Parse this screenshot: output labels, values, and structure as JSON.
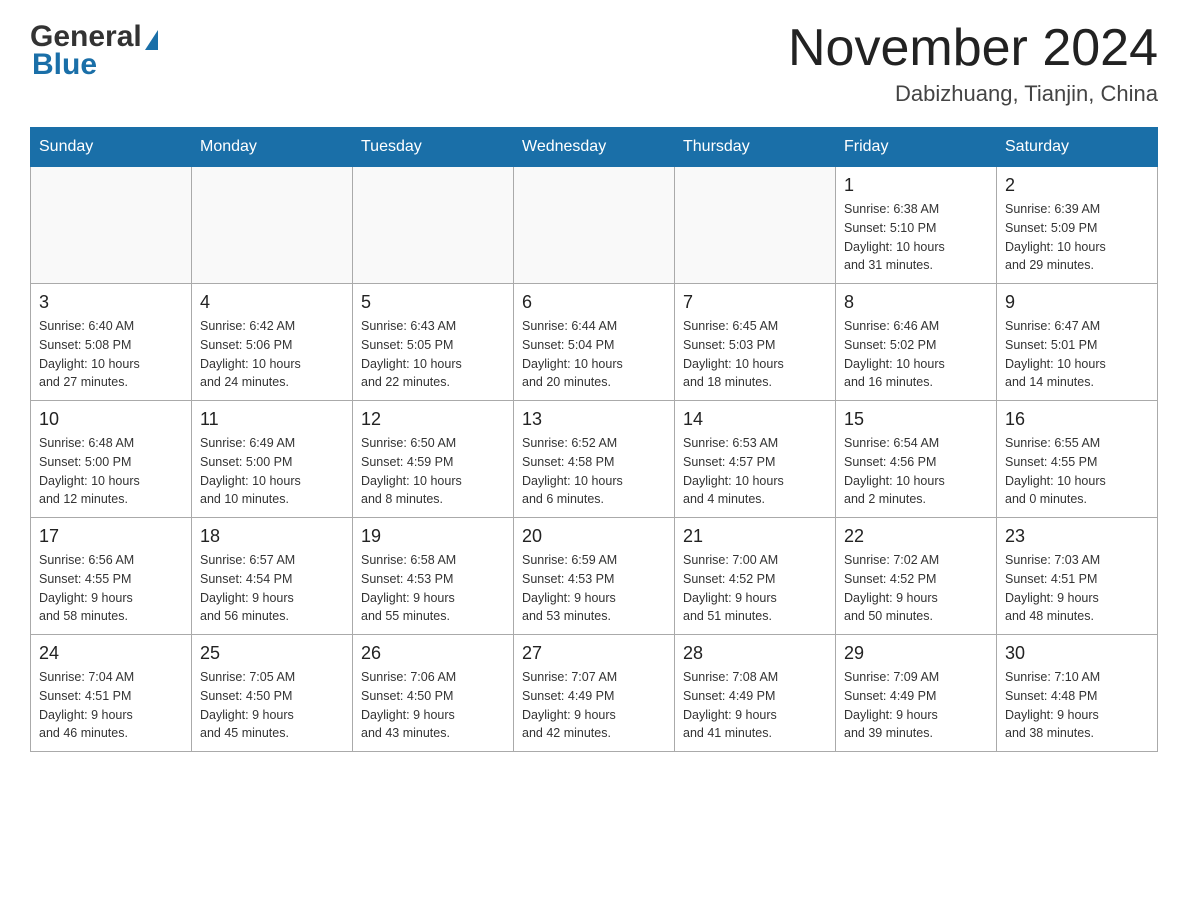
{
  "header": {
    "month_title": "November 2024",
    "location": "Dabizhuang, Tianjin, China",
    "logo_general": "General",
    "logo_blue": "Blue"
  },
  "weekdays": [
    "Sunday",
    "Monday",
    "Tuesday",
    "Wednesday",
    "Thursday",
    "Friday",
    "Saturday"
  ],
  "weeks": [
    [
      {
        "day": "",
        "info": ""
      },
      {
        "day": "",
        "info": ""
      },
      {
        "day": "",
        "info": ""
      },
      {
        "day": "",
        "info": ""
      },
      {
        "day": "",
        "info": ""
      },
      {
        "day": "1",
        "info": "Sunrise: 6:38 AM\nSunset: 5:10 PM\nDaylight: 10 hours\nand 31 minutes."
      },
      {
        "day": "2",
        "info": "Sunrise: 6:39 AM\nSunset: 5:09 PM\nDaylight: 10 hours\nand 29 minutes."
      }
    ],
    [
      {
        "day": "3",
        "info": "Sunrise: 6:40 AM\nSunset: 5:08 PM\nDaylight: 10 hours\nand 27 minutes."
      },
      {
        "day": "4",
        "info": "Sunrise: 6:42 AM\nSunset: 5:06 PM\nDaylight: 10 hours\nand 24 minutes."
      },
      {
        "day": "5",
        "info": "Sunrise: 6:43 AM\nSunset: 5:05 PM\nDaylight: 10 hours\nand 22 minutes."
      },
      {
        "day": "6",
        "info": "Sunrise: 6:44 AM\nSunset: 5:04 PM\nDaylight: 10 hours\nand 20 minutes."
      },
      {
        "day": "7",
        "info": "Sunrise: 6:45 AM\nSunset: 5:03 PM\nDaylight: 10 hours\nand 18 minutes."
      },
      {
        "day": "8",
        "info": "Sunrise: 6:46 AM\nSunset: 5:02 PM\nDaylight: 10 hours\nand 16 minutes."
      },
      {
        "day": "9",
        "info": "Sunrise: 6:47 AM\nSunset: 5:01 PM\nDaylight: 10 hours\nand 14 minutes."
      }
    ],
    [
      {
        "day": "10",
        "info": "Sunrise: 6:48 AM\nSunset: 5:00 PM\nDaylight: 10 hours\nand 12 minutes."
      },
      {
        "day": "11",
        "info": "Sunrise: 6:49 AM\nSunset: 5:00 PM\nDaylight: 10 hours\nand 10 minutes."
      },
      {
        "day": "12",
        "info": "Sunrise: 6:50 AM\nSunset: 4:59 PM\nDaylight: 10 hours\nand 8 minutes."
      },
      {
        "day": "13",
        "info": "Sunrise: 6:52 AM\nSunset: 4:58 PM\nDaylight: 10 hours\nand 6 minutes."
      },
      {
        "day": "14",
        "info": "Sunrise: 6:53 AM\nSunset: 4:57 PM\nDaylight: 10 hours\nand 4 minutes."
      },
      {
        "day": "15",
        "info": "Sunrise: 6:54 AM\nSunset: 4:56 PM\nDaylight: 10 hours\nand 2 minutes."
      },
      {
        "day": "16",
        "info": "Sunrise: 6:55 AM\nSunset: 4:55 PM\nDaylight: 10 hours\nand 0 minutes."
      }
    ],
    [
      {
        "day": "17",
        "info": "Sunrise: 6:56 AM\nSunset: 4:55 PM\nDaylight: 9 hours\nand 58 minutes."
      },
      {
        "day": "18",
        "info": "Sunrise: 6:57 AM\nSunset: 4:54 PM\nDaylight: 9 hours\nand 56 minutes."
      },
      {
        "day": "19",
        "info": "Sunrise: 6:58 AM\nSunset: 4:53 PM\nDaylight: 9 hours\nand 55 minutes."
      },
      {
        "day": "20",
        "info": "Sunrise: 6:59 AM\nSunset: 4:53 PM\nDaylight: 9 hours\nand 53 minutes."
      },
      {
        "day": "21",
        "info": "Sunrise: 7:00 AM\nSunset: 4:52 PM\nDaylight: 9 hours\nand 51 minutes."
      },
      {
        "day": "22",
        "info": "Sunrise: 7:02 AM\nSunset: 4:52 PM\nDaylight: 9 hours\nand 50 minutes."
      },
      {
        "day": "23",
        "info": "Sunrise: 7:03 AM\nSunset: 4:51 PM\nDaylight: 9 hours\nand 48 minutes."
      }
    ],
    [
      {
        "day": "24",
        "info": "Sunrise: 7:04 AM\nSunset: 4:51 PM\nDaylight: 9 hours\nand 46 minutes."
      },
      {
        "day": "25",
        "info": "Sunrise: 7:05 AM\nSunset: 4:50 PM\nDaylight: 9 hours\nand 45 minutes."
      },
      {
        "day": "26",
        "info": "Sunrise: 7:06 AM\nSunset: 4:50 PM\nDaylight: 9 hours\nand 43 minutes."
      },
      {
        "day": "27",
        "info": "Sunrise: 7:07 AM\nSunset: 4:49 PM\nDaylight: 9 hours\nand 42 minutes."
      },
      {
        "day": "28",
        "info": "Sunrise: 7:08 AM\nSunset: 4:49 PM\nDaylight: 9 hours\nand 41 minutes."
      },
      {
        "day": "29",
        "info": "Sunrise: 7:09 AM\nSunset: 4:49 PM\nDaylight: 9 hours\nand 39 minutes."
      },
      {
        "day": "30",
        "info": "Sunrise: 7:10 AM\nSunset: 4:48 PM\nDaylight: 9 hours\nand 38 minutes."
      }
    ]
  ]
}
